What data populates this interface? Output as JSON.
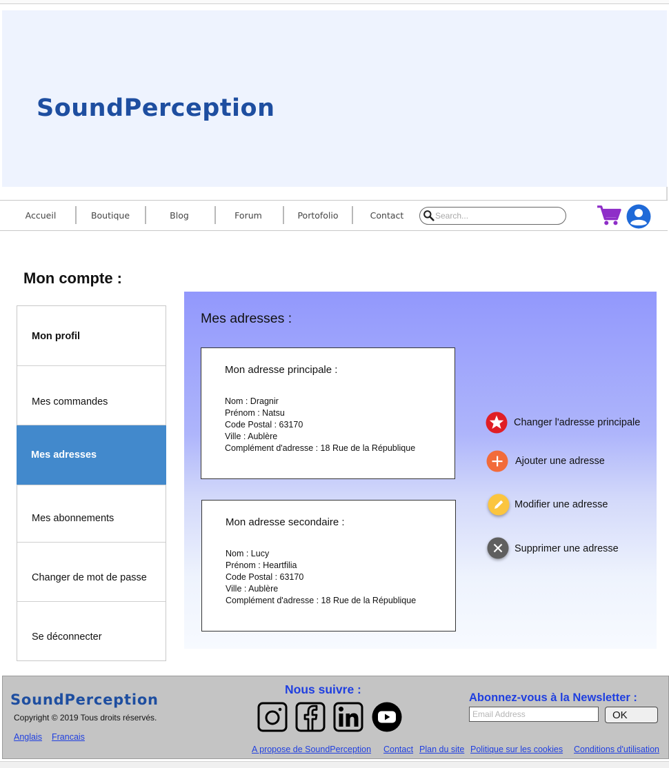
{
  "brand": {
    "name": "SoundPerception"
  },
  "nav": {
    "items": [
      "Accueil",
      "Boutique",
      "Blog",
      "Forum",
      "Portofolio",
      "Contact"
    ],
    "search_placeholder": "Search...",
    "cart_icon": "cart-icon",
    "user_icon": "user-icon",
    "accent_color": "#8e2ec8",
    "user_color": "#1f6ad8"
  },
  "page": {
    "title": "Mon compte :"
  },
  "sidebar": {
    "items": [
      {
        "label": "Mon profil",
        "bold": true
      },
      {
        "label": "Mes commandes"
      },
      {
        "label": "Mes adresses",
        "active": true
      },
      {
        "label": "Mes abonnements"
      },
      {
        "label": "Changer de mot de passe"
      },
      {
        "label": "Se déconnecter"
      }
    ],
    "active_color": "#4289cc"
  },
  "main": {
    "title": "Mes adresses :",
    "addresses": [
      {
        "title": "Mon adresse principale :",
        "lines": [
          "Nom : Dragnir",
          "Prénom : Natsu",
          "Code Postal : 63170",
          "Ville : Aublère",
          "Complément d'adresse : 18 Rue de la République"
        ]
      },
      {
        "title": "Mon adresse secondaire :",
        "lines": [
          "Nom : Lucy",
          "Prénom : Heartfilia",
          "Code Postal : 63170",
          "Ville : Aublère",
          "Complément d'adresse : 18 Rue de la République"
        ]
      }
    ],
    "actions": [
      {
        "label": "Changer l'adresse principale",
        "icon": "star-icon",
        "color": "#e01e25"
      },
      {
        "label": "Ajouter une adresse",
        "icon": "plus-icon",
        "color": "#f26b3a"
      },
      {
        "label": "Modifier une adresse",
        "icon": "pencil-icon",
        "color": "#fbc53f"
      },
      {
        "label": "Supprimer une adresse",
        "icon": "close-icon",
        "color": "#5f5f5f"
      }
    ]
  },
  "footer": {
    "brand": "SoundPerception",
    "copyright": "Copyright © 2019 Tous droits réservés.",
    "languages": [
      "Anglais",
      "Francais"
    ],
    "follow_title": "Nous suivre :",
    "social": [
      "instagram-icon",
      "facebook-icon",
      "linkedin-icon",
      "youtube-icon"
    ],
    "newsletter_title": "Abonnez-vous à la Newsletter :",
    "email_placeholder": "Email Address",
    "ok_label": "OK",
    "links": [
      "A propose de SoundPerception",
      "Contact",
      "Plan du site",
      "Politique sur les cookies",
      "Conditions d'utilisation"
    ]
  }
}
